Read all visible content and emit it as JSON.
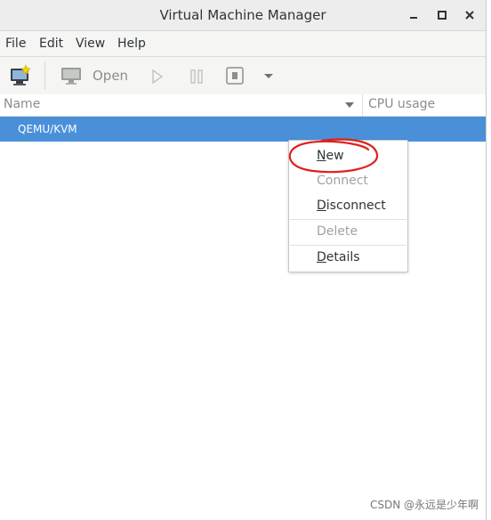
{
  "window": {
    "title": "Virtual Machine Manager"
  },
  "menubar": {
    "items": [
      "File",
      "Edit",
      "View",
      "Help"
    ]
  },
  "toolbar": {
    "open_label": "Open"
  },
  "columns": {
    "name": "Name",
    "cpu": "CPU usage"
  },
  "connections": [
    {
      "label": "QEMU/KVM",
      "selected": true
    }
  ],
  "context_menu": {
    "new": {
      "label": "New",
      "mnemonic": "N",
      "rest": "ew"
    },
    "connect": {
      "label": "Connect"
    },
    "disconnect": {
      "label": "Disconnect",
      "mnemonic": "D",
      "rest": "isconnect"
    },
    "delete": {
      "label": "Delete"
    },
    "details": {
      "label": "Details",
      "mnemonic": "D",
      "rest": "etails"
    }
  },
  "annotation": {
    "color": "#e0201c",
    "target": "New"
  },
  "watermark": "CSDN @永远是少年啊",
  "colors": {
    "selection": "#4a90d9",
    "titlebar": "#ededed"
  }
}
